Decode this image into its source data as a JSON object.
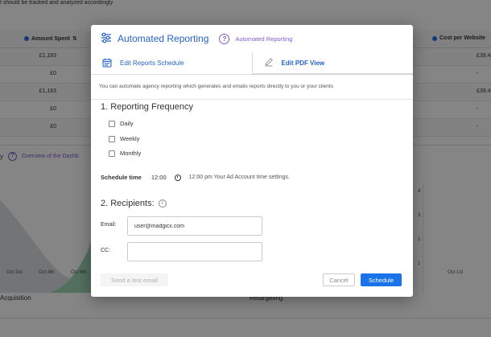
{
  "background": {
    "top_note": "t should be tracked and analyzed accordingly",
    "table": {
      "col_amount_spent": "Amount Spent",
      "col_cost_per_website": "Cost per Website",
      "rows": [
        {
          "amount": "£1,183",
          "right": "£39.4"
        },
        {
          "amount": "£0",
          "right": "-"
        },
        {
          "amount": "£1,183",
          "right": "£39.4"
        },
        {
          "amount": "£0",
          "right": "-"
        },
        {
          "amount": "£0",
          "right": "-"
        }
      ]
    },
    "section_title_fragment": "y",
    "section_subtitle": "Overview of the Dashb",
    "x_labels": [
      "Oct 3rd",
      "Oct 4th",
      "Oct 6th",
      "Oct 1st"
    ],
    "right_axis": [
      "4",
      "3",
      "2",
      "1"
    ],
    "bottom_label_left": "Acquisition",
    "bottom_label_mid": "Retargeting"
  },
  "modal": {
    "title": "Automated Reporting",
    "help_label": "Automated Reporting",
    "tabs": [
      {
        "label": "Edit Reports Schedule",
        "icon": "calendar-icon"
      },
      {
        "label": "Edit PDF View",
        "icon": "pencil-icon"
      }
    ],
    "intro": "You can automate agency reporting which generates and emails reports directly to you or your clients",
    "frequency": {
      "title": "1. Reporting Frequency",
      "options": [
        "Daily",
        "Weekly",
        "Monthly"
      ]
    },
    "schedule": {
      "label": "Schedule time",
      "time_value": "12:00",
      "note": "12:00 pm Your Ad Account time settings."
    },
    "recipients": {
      "title": "2. Recipients:",
      "email_label": "Email:",
      "email_value": "user@madgicx.com",
      "cc_label": "CC:",
      "cc_value": ""
    },
    "buttons": {
      "test_email": "Send a test email",
      "cancel": "Cancel",
      "schedule": "Schedule"
    }
  },
  "colors": {
    "primary_blue": "#1a73e8",
    "title_blue": "#2563c7",
    "help_purple": "#7c5ccf",
    "chart_green": "#7fc8a0"
  }
}
